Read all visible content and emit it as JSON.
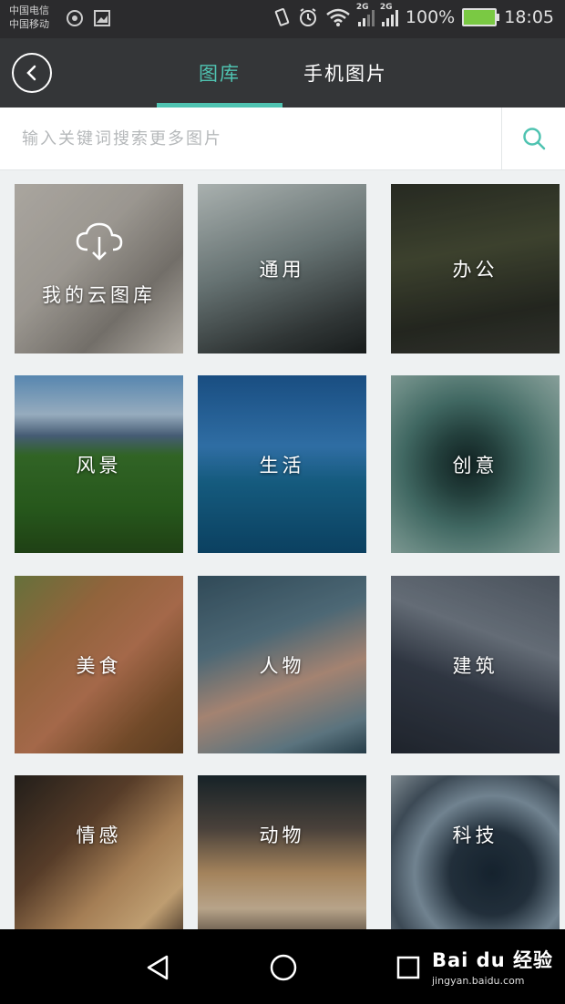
{
  "status_bar": {
    "carrier_1": "中国电信",
    "carrier_2": "中国移动",
    "network_1": "2G",
    "network_2": "2G",
    "battery": "100%",
    "time": "18:05",
    "icons": [
      "hotspot-icon",
      "image-icon",
      "vibrate-icon",
      "alarm-icon",
      "wifi-icon",
      "signal-icon",
      "signal-icon",
      "battery-charging-icon"
    ]
  },
  "header": {
    "tabs": [
      {
        "label": "图库",
        "active": true
      },
      {
        "label": "手机图片",
        "active": false
      }
    ],
    "accent": "#4fc3b1"
  },
  "search": {
    "placeholder": "输入关键词搜索更多图片",
    "value": ""
  },
  "categories": [
    {
      "label": "我的云图库",
      "icon": "cloud-download-icon"
    },
    {
      "label": "通用"
    },
    {
      "label": "办公"
    },
    {
      "label": "风景"
    },
    {
      "label": "生活"
    },
    {
      "label": "创意"
    },
    {
      "label": "美食"
    },
    {
      "label": "人物"
    },
    {
      "label": "建筑"
    },
    {
      "label": "情感"
    },
    {
      "label": "动物"
    },
    {
      "label": "科技"
    }
  ],
  "nav": {
    "buttons": [
      "back-triangle-icon",
      "home-circle-icon",
      "recents-square-icon"
    ]
  },
  "watermark": {
    "logo": "Bai du 经验",
    "url": "jingyan.baidu.com"
  }
}
